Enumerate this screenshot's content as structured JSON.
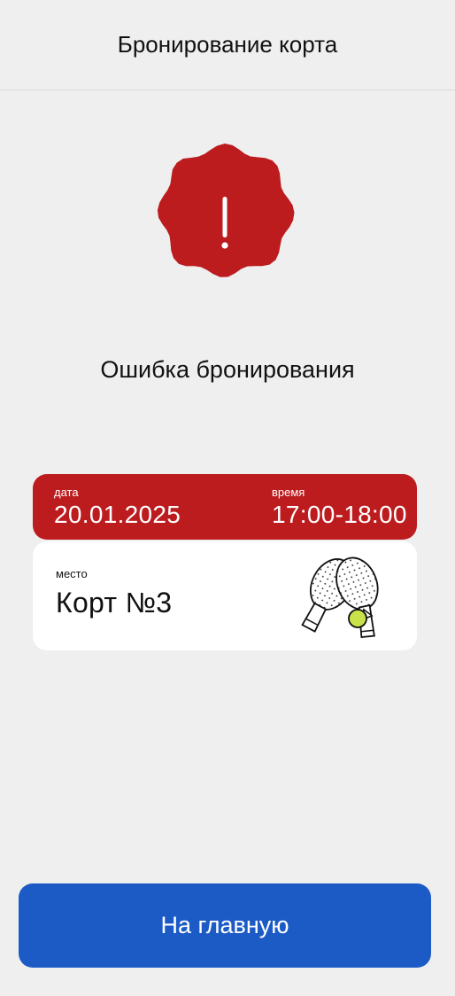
{
  "header": {
    "title": "Бронирование корта"
  },
  "status": {
    "icon": "error-badge-icon",
    "message": "Ошибка бронирования",
    "color": "#bd1c1f"
  },
  "booking": {
    "date_label": "дата",
    "date_value": "20.01.2025",
    "time_label": "время",
    "time_value": "17:00-18:00",
    "place_label": "место",
    "place_value": "Корт №3",
    "illustration": "padel-racket-icon"
  },
  "actions": {
    "home_label": "На главную",
    "home_color": "#1c5bc6"
  }
}
